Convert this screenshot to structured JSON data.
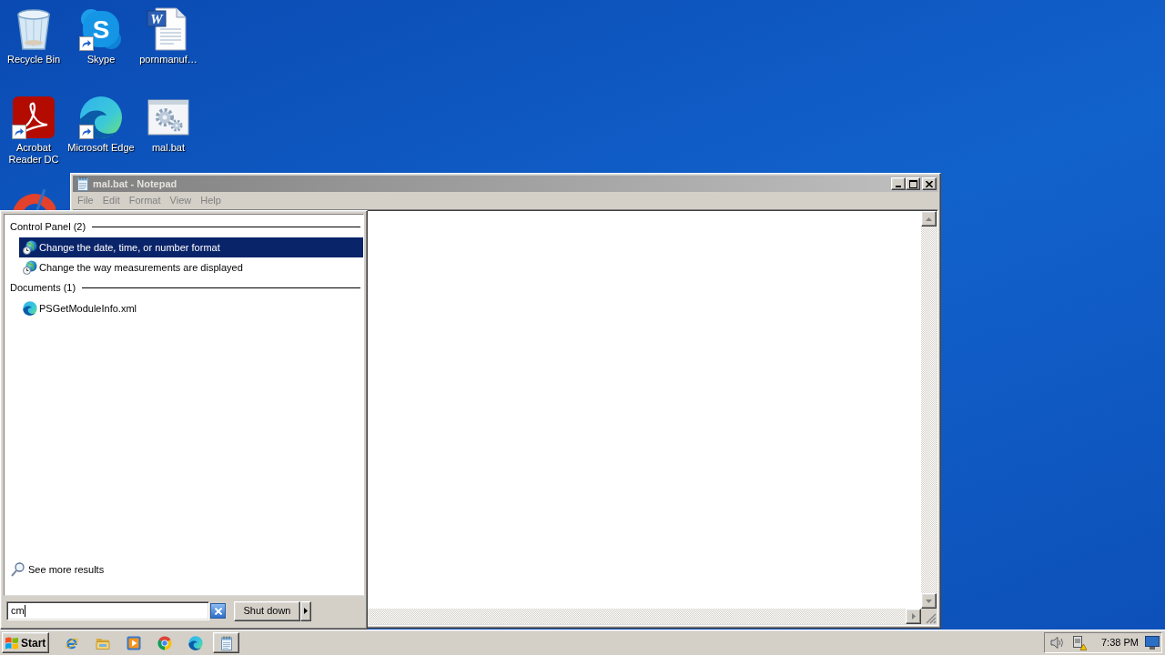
{
  "desktop": {
    "icons": [
      {
        "kind": "recycle-bin",
        "label": "Recycle Bin",
        "shortcut": false
      },
      {
        "kind": "skype",
        "label": "Skype",
        "glyph": "S",
        "shortcut": true
      },
      {
        "kind": "word-document",
        "label": "pornmanuf…",
        "glyph": "W",
        "shortcut": false
      },
      {
        "kind": "acrobat",
        "label": "Acrobat Reader DC",
        "shortcut": true
      },
      {
        "kind": "edge",
        "label": "Microsoft Edge",
        "shortcut": true
      },
      {
        "kind": "batch-file",
        "label": "mal.bat",
        "shortcut": false
      },
      {
        "kind": "gauge"
      }
    ]
  },
  "notepad": {
    "title": "mal.bat - Notepad",
    "active": false,
    "menu": [
      "File",
      "Edit",
      "Format",
      "View",
      "Help"
    ]
  },
  "start_menu": {
    "groups": [
      {
        "title": "Control Panel (2)",
        "items": [
          {
            "kind": "control-panel",
            "label": "Change the date, time, or number format",
            "selected": true
          },
          {
            "kind": "control-panel",
            "label": "Change the way measurements are displayed",
            "selected": false
          }
        ]
      },
      {
        "title": "Documents (1)",
        "items": [
          {
            "kind": "edge-document",
            "label": "PSGetModuleInfo.xml",
            "selected": false
          }
        ]
      }
    ],
    "see_more": "See more results",
    "search": {
      "value": "cm"
    },
    "shutdown": "Shut down"
  },
  "taskbar": {
    "start": "Start",
    "quick_launch": [
      {
        "kind": "internet-explorer"
      },
      {
        "kind": "folder"
      },
      {
        "kind": "media-player"
      },
      {
        "kind": "chrome"
      },
      {
        "kind": "edge"
      }
    ],
    "tasks": [
      {
        "kind": "notepad",
        "selected": false
      }
    ],
    "clock": "7:38 PM"
  }
}
